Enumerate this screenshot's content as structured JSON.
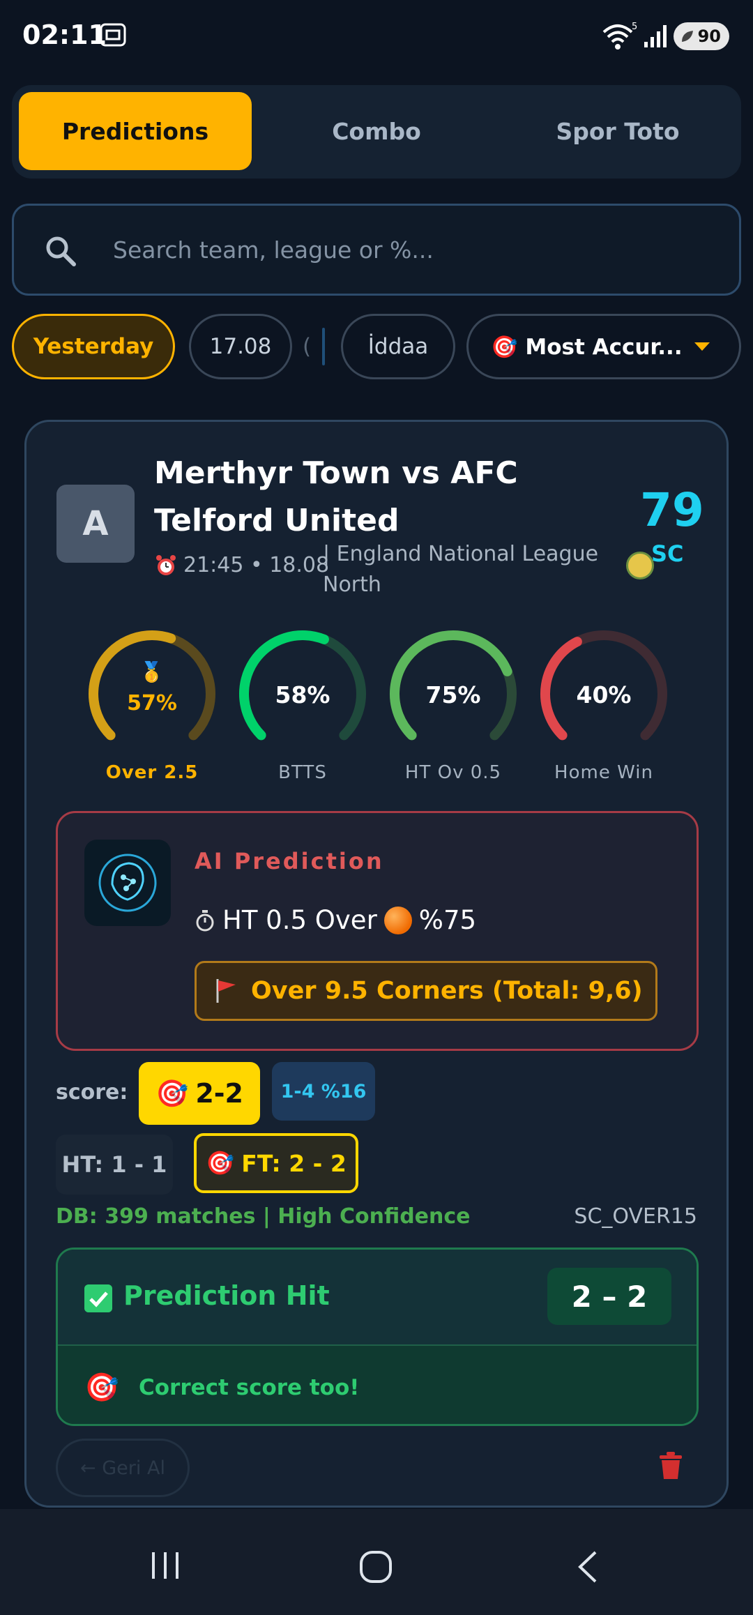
{
  "status_bar": {
    "time": "02:11",
    "wifi_label": "5",
    "battery": "90"
  },
  "tabs": [
    {
      "label": "Predictions",
      "active": true
    },
    {
      "label": "Combo",
      "active": false
    },
    {
      "label": "Spor Toto",
      "active": false
    }
  ],
  "search": {
    "placeholder": "Search team, league or %..."
  },
  "filters": {
    "day": "Yesterday",
    "date": "17.08",
    "partial": "(",
    "market": "İddaa",
    "sort": "🎯 Most Accur..."
  },
  "match": {
    "avatar_letter": "A",
    "title": "Merthyr Town vs AFC Telford United",
    "time": "21:45 • 18.08",
    "league": "| England National League North",
    "sc_score": "79",
    "sc_label": "SC"
  },
  "gauges": [
    {
      "label": "Over 2.5",
      "value": "57%",
      "percent": 57,
      "color": "#d4a017",
      "track": "#5a4a1e",
      "highlight": true
    },
    {
      "label": "BTTS",
      "value": "58%",
      "percent": 58,
      "color": "#00d26a",
      "track": "#1f4a3c"
    },
    {
      "label": "HT Ov 0.5",
      "value": "75%",
      "percent": 75,
      "color": "#5cb85c",
      "track": "#2b4a38"
    },
    {
      "label": "Home Win",
      "value": "40%",
      "percent": 40,
      "color": "#e0474c",
      "track": "#3f2b33"
    }
  ],
  "ai_prediction": {
    "title": "AI Prediction",
    "line": "HT 0.5 Over",
    "line_pct": "%75",
    "corners": "Over 9.5 Corners (Total: 9,6)"
  },
  "scores": {
    "label": "score:",
    "main": "2-2",
    "alt": "1-4 %16",
    "ht": "HT: 1 - 1",
    "ft": "FT: 2 - 2"
  },
  "db": {
    "info": "DB: 399 matches | High Confidence",
    "strategy": "SC_OVER15"
  },
  "result": {
    "title": "Prediction Hit",
    "score": "2 – 2",
    "note": "Correct score too!"
  },
  "actions": {
    "undo": "← Geri Al"
  },
  "colors": {
    "accent": "#ffb300",
    "background": "#0c1421",
    "card": "#152131",
    "success": "#2ecc71"
  }
}
